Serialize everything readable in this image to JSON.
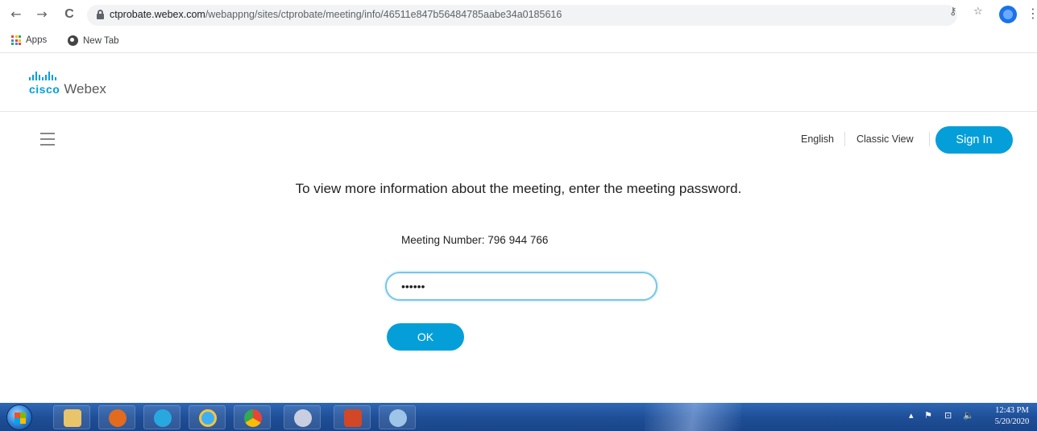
{
  "browser": {
    "url_host": "ctprobate.webex.com",
    "url_path": "/webappng/sites/ctprobate/meeting/info/46511e847b56484785aabe34a0185616",
    "back_glyph": "←",
    "forward_glyph": "→",
    "reload_glyph": "C",
    "key_glyph": "⚷",
    "star_glyph": "☆",
    "menu_glyph": "⋮",
    "bookmarks": [
      {
        "label": "Apps",
        "icon": "apps-grid-icon"
      },
      {
        "label": "New Tab",
        "icon": "globe-icon"
      }
    ]
  },
  "webex": {
    "brand_cisco": "cisco",
    "brand_webex": "Webex",
    "nav_english": "English",
    "nav_classic_view": "Classic View",
    "sign_in": "Sign In",
    "prompt": "To view more information about the meeting, enter the meeting password.",
    "meeting_number": "Meeting Number: 796 944 766",
    "password_masked": "••••••",
    "ok": "OK",
    "accent_color": "#049fd9"
  },
  "taskbar": {
    "apps": [
      "file-explorer-icon",
      "media-icon",
      "skype-icon",
      "internet-explorer-icon",
      "chrome-icon",
      "snipping-icon",
      "powerpoint-icon",
      "paint-icon"
    ],
    "tray_arrow": "▴",
    "tray_flag": "⚑",
    "tray_network": "⊡",
    "tray_volume": "🔈",
    "time": "12:43 PM",
    "date": "5/20/2020"
  }
}
